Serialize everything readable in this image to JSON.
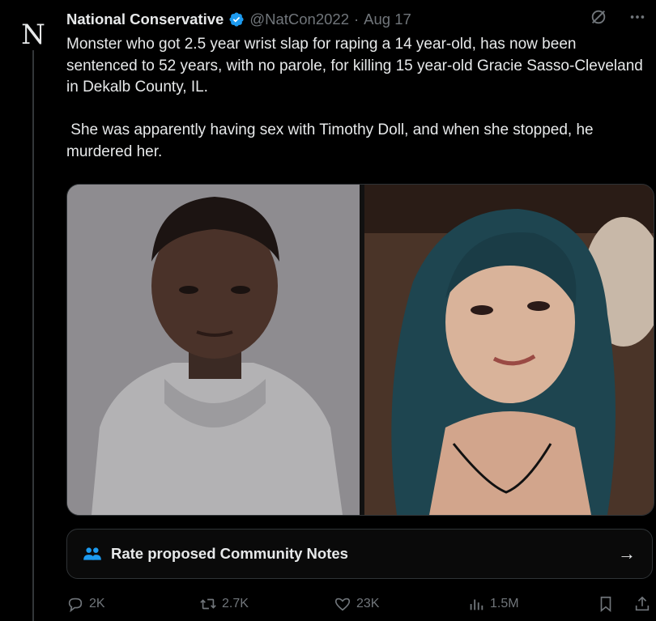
{
  "post": {
    "author_name": "National Conservative",
    "handle": "@NatCon2022",
    "separator": "·",
    "date": "Aug 17",
    "text": "Monster who got 2.5 year wrist slap for raping a 14 year-old, has now been sentenced to 52 years, with no parole, for killing 15 year-old Gracie Sasso-Cleveland in Dekalb County, IL.\n\n She was apparently having sex with Timothy Doll, and when she stopped, he murdered her."
  },
  "avatar": {
    "glyph": "N"
  },
  "community_notes": {
    "label": "Rate proposed Community Notes",
    "arrow": "→"
  },
  "actions": {
    "replies": "2K",
    "reposts": "2.7K",
    "likes": "23K",
    "views": "1.5M"
  },
  "colors": {
    "background": "#000000",
    "text": "#e7e9ea",
    "muted": "#71767b",
    "verified": "#1d9bf0",
    "notes_icon": "#1d9bf0"
  },
  "icons": {
    "verified": "verified-badge-icon",
    "grok": "grok-icon",
    "more": "more-icon",
    "reply": "reply-icon",
    "repost": "repost-icon",
    "like": "heart-icon",
    "views": "views-icon",
    "bookmark": "bookmark-icon",
    "share": "share-icon"
  }
}
